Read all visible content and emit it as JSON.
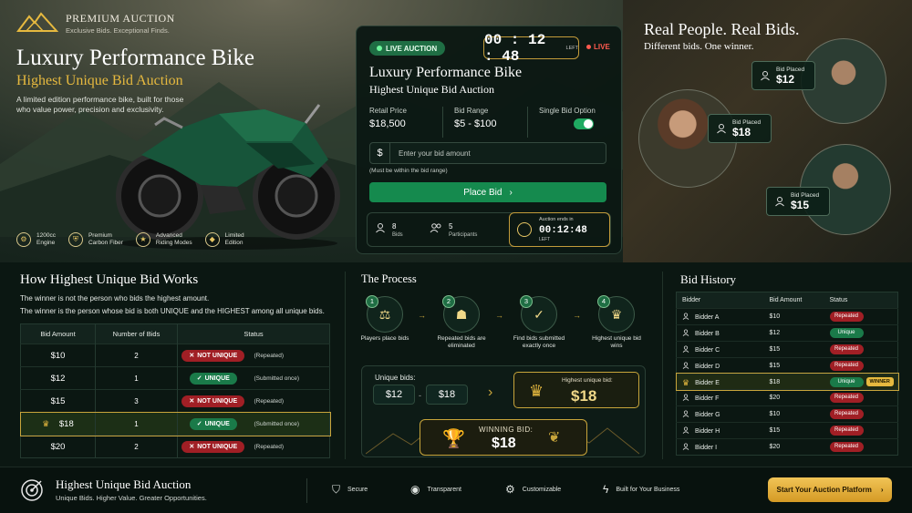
{
  "brand": {
    "name": "PREMIUM AUCTION",
    "tagline": "Exclusive Bids. Exceptional Finds."
  },
  "hero": {
    "title": "Luxury Performance Bike",
    "subtitle": "Highest Unique Bid Auction",
    "description": "A limited edition performance bike, built for those who value power, precision and exclusivity.",
    "features": [
      {
        "icon": "engine-icon",
        "line1": "1200cc",
        "line2": "Engine"
      },
      {
        "icon": "shield-icon",
        "line1": "Premium",
        "line2": "Carbon Fiber"
      },
      {
        "icon": "star-icon",
        "line1": "Advanced",
        "line2": "Riding Modes"
      },
      {
        "icon": "diamond-icon",
        "line1": "Limited",
        "line2": "Edition"
      }
    ]
  },
  "auction_card": {
    "live_label": "LIVE AUCTION",
    "timer": "00 : 12 : 48",
    "timer_left": "LEFT",
    "live_indicator": "LIVE",
    "title": "Luxury Performance Bike",
    "subtitle": "Highest Unique Bid Auction",
    "retail_label": "Retail Price",
    "retail_value": "$18,500",
    "range_label": "Bid Range",
    "range_value": "$5 - $100",
    "single_bid_label": "Single Bid Option",
    "single_bid_enabled": true,
    "currency_symbol": "$",
    "input_placeholder": "Enter your bid amount",
    "input_note": "(Must be within the bid range)",
    "place_bid_label": "Place Bid",
    "bids_count": "8",
    "bids_label": "Bids",
    "participants_count": "5",
    "participants_label": "Participants",
    "ends_label": "Auction ends in",
    "ends_value": "00:12:48",
    "ends_left": "LEFT"
  },
  "people": {
    "title": "Real People. Real Bids.",
    "subtitle": "Different bids. One winner.",
    "tags": [
      {
        "label": "Bid Placed",
        "amount": "$12"
      },
      {
        "label": "Bid Placed",
        "amount": "$18"
      },
      {
        "label": "Bid Placed",
        "amount": "$15"
      }
    ]
  },
  "how": {
    "title": "How Highest Unique Bid Works",
    "line1": "The winner is not the person who bids the highest amount.",
    "line2": "The winner is the person whose bid is both UNIQUE and the HIGHEST among all unique bids.",
    "columns": [
      "Bid Amount",
      "Number of Bids",
      "Status"
    ],
    "rows": [
      {
        "amount": "$10",
        "count": "2",
        "status": "NOT UNIQUE",
        "note": "(Repeated)",
        "unique": false,
        "highlight": false
      },
      {
        "amount": "$12",
        "count": "1",
        "status": "UNIQUE",
        "note": "(Submitted once)",
        "unique": true,
        "highlight": false
      },
      {
        "amount": "$15",
        "count": "3",
        "status": "NOT UNIQUE",
        "note": "(Repeated)",
        "unique": false,
        "highlight": false
      },
      {
        "amount": "$18",
        "count": "1",
        "status": "UNIQUE",
        "note": "(Submitted once)",
        "unique": true,
        "highlight": true
      },
      {
        "amount": "$20",
        "count": "2",
        "status": "NOT UNIQUE",
        "note": "(Repeated)",
        "unique": false,
        "highlight": false
      }
    ]
  },
  "process": {
    "title": "The Process",
    "steps": [
      {
        "num": "1",
        "icon": "gavel-icon",
        "label": "Players place bids"
      },
      {
        "num": "2",
        "icon": "people-icon",
        "label": "Repeated bids are eliminated"
      },
      {
        "num": "3",
        "icon": "check-circle-icon",
        "label": "Find bids submitted exactly once"
      },
      {
        "num": "4",
        "icon": "crown-icon",
        "label": "Highest unique bid wins"
      }
    ],
    "unique_label": "Unique bids:",
    "unique_bids": [
      "$12",
      "$18"
    ],
    "highest_label": "Highest unique bid:",
    "highest_value": "$18",
    "winning_label": "WINNING BID:",
    "winning_value": "$18"
  },
  "history": {
    "title": "Bid History",
    "columns": [
      "Bidder",
      "Bid Amount",
      "Status"
    ],
    "rows": [
      {
        "bidder": "Bidder A",
        "amount": "$10",
        "status": "Repeated"
      },
      {
        "bidder": "Bidder B",
        "amount": "$12",
        "status": "Unique"
      },
      {
        "bidder": "Bidder C",
        "amount": "$15",
        "status": "Repeated"
      },
      {
        "bidder": "Bidder D",
        "amount": "$15",
        "status": "Repeated"
      },
      {
        "bidder": "Bidder E",
        "amount": "$18",
        "status": "Unique",
        "winner": "WINNER"
      },
      {
        "bidder": "Bidder F",
        "amount": "$20",
        "status": "Repeated"
      },
      {
        "bidder": "Bidder G",
        "amount": "$10",
        "status": "Repeated"
      },
      {
        "bidder": "Bidder H",
        "amount": "$15",
        "status": "Repeated"
      },
      {
        "bidder": "Bidder I",
        "amount": "$20",
        "status": "Repeated"
      }
    ]
  },
  "footer": {
    "title": "Highest Unique Bid Auction",
    "subtitle": "Unique Bids. Higher Value. Greater Opportunities.",
    "features": [
      {
        "icon": "shield-check-icon",
        "label": "Secure"
      },
      {
        "icon": "eye-icon",
        "label": "Transparent"
      },
      {
        "icon": "gear-icon",
        "label": "Customizable"
      },
      {
        "icon": "bolt-icon",
        "label": "Built for Your Business"
      }
    ],
    "cta_label": "Start Your Auction Platform"
  },
  "colors": {
    "accent_gold": "#e6b93f",
    "accent_green": "#158a4e",
    "danger_red": "#a01f25",
    "bg_dark": "#0b1712"
  }
}
